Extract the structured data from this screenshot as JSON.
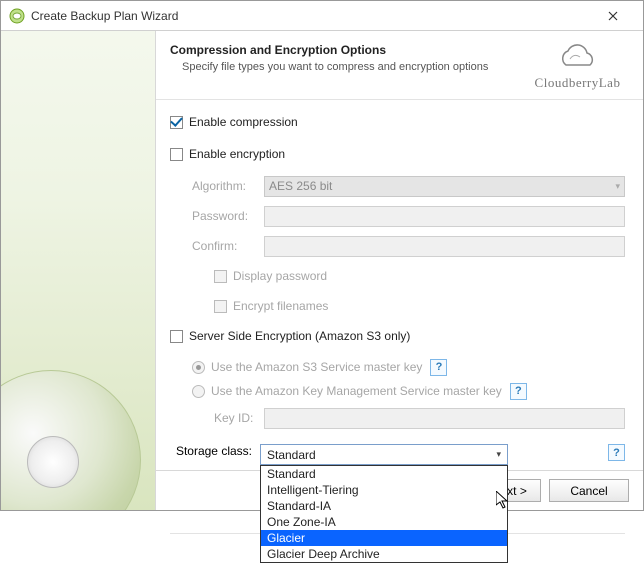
{
  "window": {
    "title": "Create Backup Plan Wizard"
  },
  "header": {
    "title": "Compression and Encryption Options",
    "subtitle": "Specify file types you want to compress and encryption options",
    "brand": "CloudberryLab"
  },
  "form": {
    "enable_compression": "Enable compression",
    "enable_encryption": "Enable encryption",
    "algorithm_label": "Algorithm:",
    "algorithm_value": "AES 256 bit",
    "password_label": "Password:",
    "confirm_label": "Confirm:",
    "display_password": "Display password",
    "encrypt_filenames": "Encrypt filenames",
    "sse_label": "Server Side Encryption (Amazon S3 only)",
    "sse_opt1": "Use the Amazon S3 Service master key",
    "sse_opt2": "Use the Amazon Key Management Service master key",
    "key_id_label": "Key ID:",
    "storage_class_label": "Storage class:",
    "storage_class_value": "Standard",
    "storage_options": [
      "Standard",
      "Intelligent-Tiering",
      "Standard-IA",
      "One Zone-IA",
      "Glacier",
      "Glacier Deep Archive"
    ],
    "storage_highlight_index": 4,
    "help_glyph": "?"
  },
  "footer": {
    "next": "xt >",
    "cancel": "Cancel"
  }
}
